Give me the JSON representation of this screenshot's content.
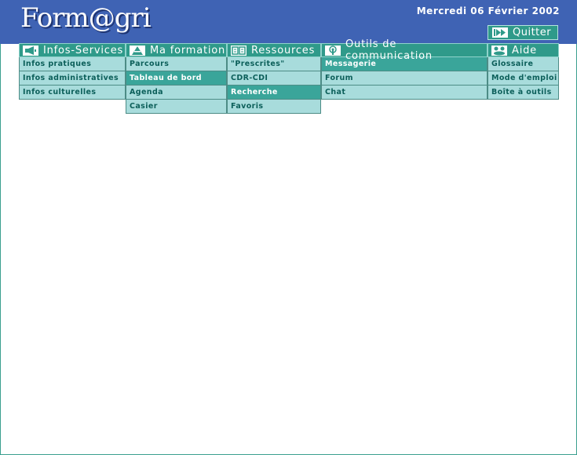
{
  "header": {
    "logo_text": "Form@gri",
    "date": "Mercredi 06 Février 2002",
    "quit_label": "Quitter"
  },
  "menus": [
    {
      "label": "Infos-Services",
      "icon": "megaphone-icon",
      "items": [
        {
          "label": "Infos pratiques",
          "active": false
        },
        {
          "label": "Infos administratives",
          "active": false
        },
        {
          "label": "Infos culturelles",
          "active": false
        }
      ]
    },
    {
      "label": "Ma formation",
      "icon": "triangle-icon",
      "items": [
        {
          "label": "Parcours",
          "active": false
        },
        {
          "label": "Tableau de bord",
          "active": true
        },
        {
          "label": "Agenda",
          "active": false
        },
        {
          "label": "Casier",
          "active": false
        }
      ]
    },
    {
      "label": "Ressources",
      "icon": "book-icon",
      "items": [
        {
          "label": "\"Prescrites\"",
          "active": false
        },
        {
          "label": "CDR-CDI",
          "active": false
        },
        {
          "label": "Recherche",
          "active": true
        },
        {
          "label": "Favoris",
          "active": false
        }
      ]
    },
    {
      "label": "Outils de communication",
      "icon": "antenna-icon",
      "items": [
        {
          "label": "Messagerie",
          "active": true
        },
        {
          "label": "Forum",
          "active": false
        },
        {
          "label": "Chat",
          "active": false
        }
      ]
    },
    {
      "label": "Aide",
      "icon": "people-icon",
      "items": [
        {
          "label": "Glossaire",
          "active": false
        },
        {
          "label": "Mode d'emploi",
          "active": false
        },
        {
          "label": "Boîte à outils",
          "active": false
        }
      ]
    }
  ],
  "colors": {
    "banner": "#3f63b4",
    "menu_header": "#2f9a8a",
    "menu_item": "#a8dcdc",
    "menu_item_active": "#3aa59a",
    "menu_text": "#0c5f5a"
  }
}
